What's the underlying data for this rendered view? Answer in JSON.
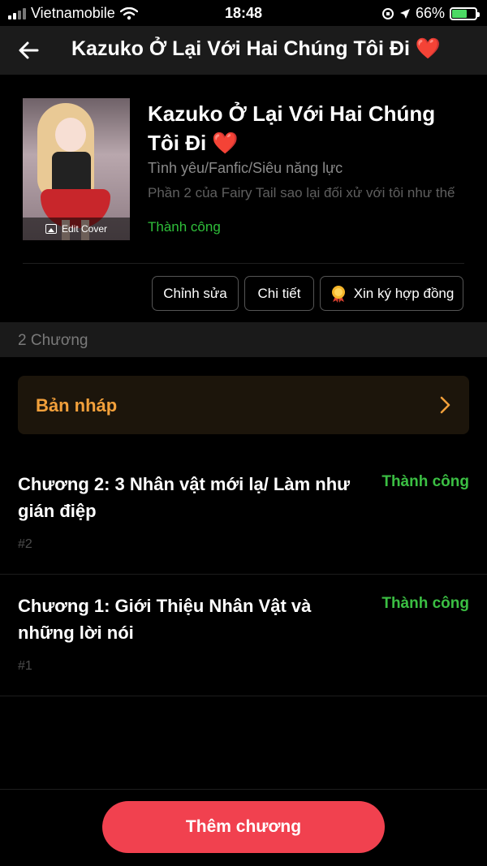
{
  "status_bar": {
    "carrier": "Vietnamobile",
    "time": "18:48",
    "battery_percent": "66%",
    "battery_level": 0.66
  },
  "header": {
    "title": "Kazuko Ở Lại Với Hai Chúng Tôi Đi ❤️"
  },
  "book": {
    "cover_label": "Edit Cover",
    "title": "Kazuko Ở Lại Với Hai Chúng Tôi Đi ❤️",
    "genre": "Tình yêu/Fanfic/Siêu năng lực",
    "description": "Phần 2 của Fairy Tail sao lại đối xử với tôi như thế",
    "status": "Thành công"
  },
  "actions": {
    "edit_label": "Chỉnh sửa",
    "details_label": "Chi tiết",
    "contract_label": "Xin ký hợp đồng"
  },
  "chapters_section": {
    "count_label": "2 Chương",
    "draft_label": "Bản nháp"
  },
  "chapters": [
    {
      "title": "Chương 2: 3 Nhân vật mới lạ/ Làm như gián điệp",
      "status": "Thành công",
      "number": "#2"
    },
    {
      "title": "Chương 1: Giới Thiệu Nhân Vật và những lời nói",
      "status": "Thành công",
      "number": "#1"
    }
  ],
  "footer": {
    "add_chapter_label": "Thêm chương"
  },
  "colors": {
    "accent": "#f1414f",
    "success": "#3bbf43",
    "draft": "#f2a03b"
  }
}
